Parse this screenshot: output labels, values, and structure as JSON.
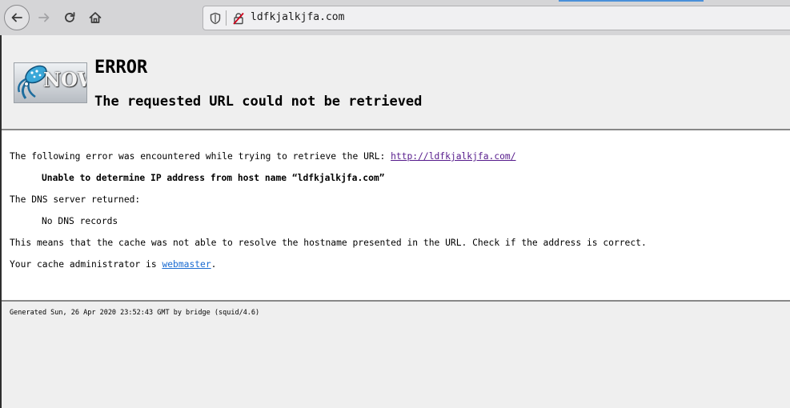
{
  "browser": {
    "url": "ldfkjalkjfa.com"
  },
  "header": {
    "logo_text": "NOW",
    "title": "ERROR",
    "subtitle": "The requested URL could not be retrieved"
  },
  "content": {
    "intro": "The following error was encountered while trying to retrieve the URL: ",
    "url_link": "http://ldfkjalkjfa.com/",
    "error_detail": "Unable to determine IP address from host name “ldfkjalkjfa.com”",
    "dns_label": "The DNS server returned:",
    "dns_result": "No DNS records",
    "explanation": "This means that the cache was not able to resolve the hostname presented in the URL. Check if the address is correct.",
    "admin_prefix": "Your cache administrator is ",
    "admin_link": "webmaster",
    "admin_suffix": "."
  },
  "footer": {
    "generated": "Generated Sun, 26 Apr 2020 23:52:43 GMT by bridge (squid/4.6)"
  }
}
